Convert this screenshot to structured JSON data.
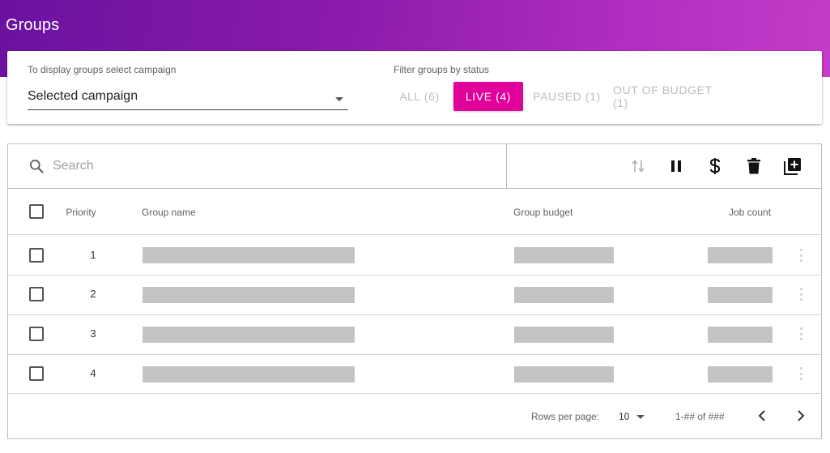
{
  "header": {
    "title": "Groups"
  },
  "filters": {
    "campaign_label": "To display groups select campaign",
    "campaign_value": "Selected campaign",
    "status_label": "Filter groups by status",
    "statuses": [
      {
        "label": "ALL (6)",
        "active": false
      },
      {
        "label": "LIVE (4)",
        "active": true
      },
      {
        "label": "PAUSED (1)",
        "active": false
      },
      {
        "label": "OUT OF BUDGET (1)",
        "active": false
      }
    ],
    "accent_color": "#e0009a"
  },
  "toolbar": {
    "search_placeholder": "Search",
    "icons": [
      "sort-icon",
      "pause-icon",
      "dollar-icon",
      "delete-icon",
      "add-box-icon"
    ]
  },
  "table": {
    "columns": [
      "Priority",
      "Group name",
      "Group budget",
      "Job count"
    ],
    "rows": [
      {
        "priority": "1"
      },
      {
        "priority": "2"
      },
      {
        "priority": "3"
      },
      {
        "priority": "4"
      }
    ]
  },
  "footer": {
    "rows_per_page_label": "Rows per page:",
    "rows_per_page_value": "10",
    "range": "1-## of ###"
  }
}
